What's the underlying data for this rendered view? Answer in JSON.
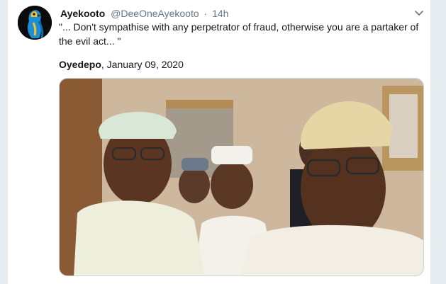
{
  "tweet": {
    "display_name": "Ayekooto",
    "handle": "@DeeOneAyekooto",
    "separator": "·",
    "time": "14h",
    "text": "\"... Don't sympathise with any perpetrator of fraud, otherwise you are a partaker of the evil act... \"",
    "quote_author": "Oyedepo",
    "quote_date": ", January 09, 2020",
    "avatar_icon": "parrot-avatar",
    "menu_icon": "chevron-down-icon"
  },
  "colors": {
    "text_primary": "#14171a",
    "text_secondary": "#657786",
    "background": "#e6ecf0",
    "card": "#ffffff"
  }
}
